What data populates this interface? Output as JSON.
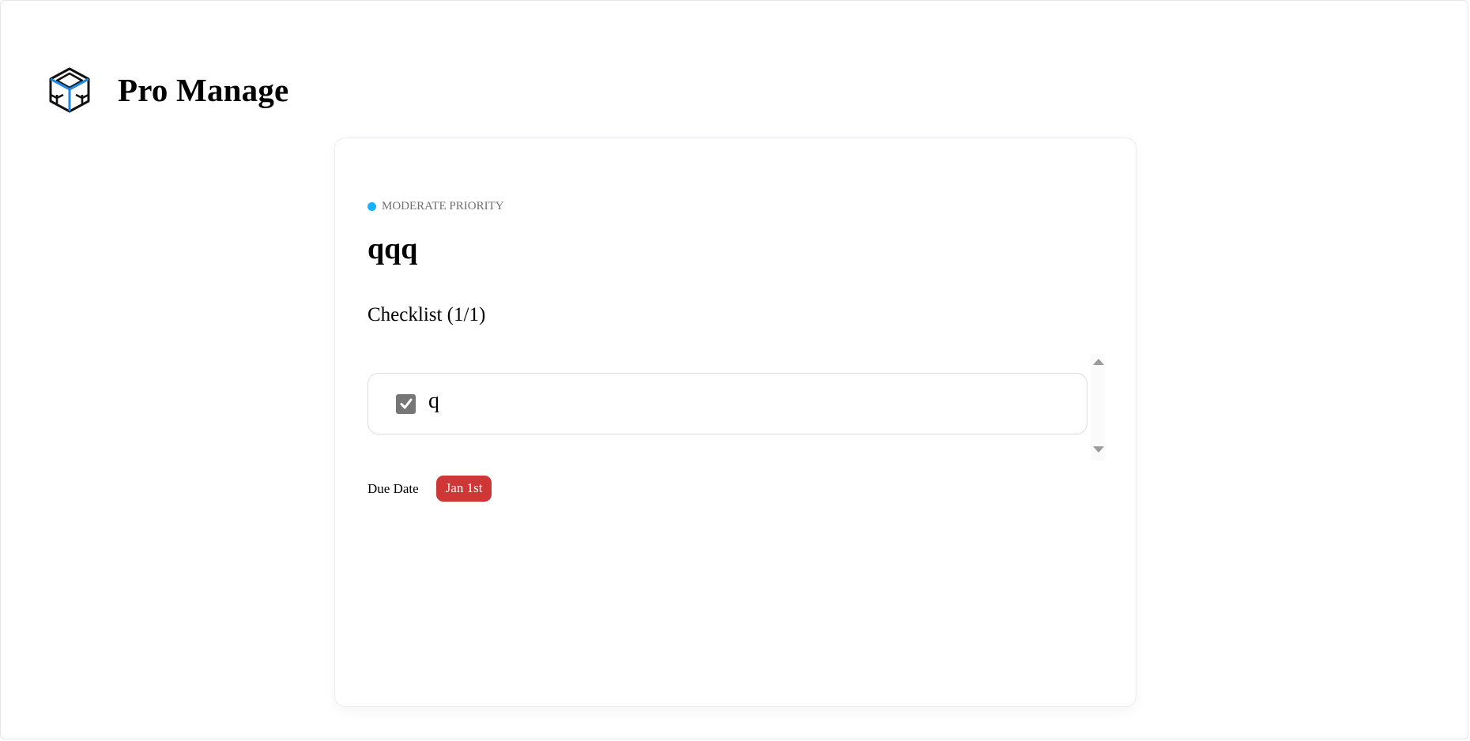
{
  "app": {
    "name": "Pro Manage",
    "logo_icon": "cube-icon"
  },
  "task": {
    "priority": {
      "label": "MODERATE PRIORITY",
      "color": "#18b0ff"
    },
    "title": "qqq",
    "checklist": {
      "title": "Checklist (1/1)",
      "items": [
        {
          "text": "q",
          "checked": true
        }
      ]
    },
    "due": {
      "label": "Due Date",
      "value": "Jan 1st",
      "badge_color": "#cf3636"
    }
  }
}
